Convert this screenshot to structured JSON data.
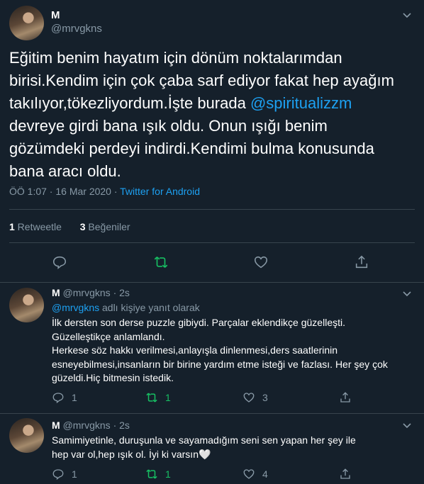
{
  "main": {
    "name": "M",
    "handle": "@mrvgkns",
    "text_before": "Eğitim benim hayatım için dönüm noktalarımdan\nbirisi.Kendim için çok çaba sarf ediyor fakat hep ayağım\ntakılıyor,tökezliyordum.İşte burada ",
    "mention": "@spiritualizzm",
    "text_after": "\n devreye girdi bana ışık oldu. Onun ışığı benim\ngözümdeki perdeyi indirdi.Kendimi bulma konusunda\nbana aracı oldu.",
    "time": "ÖÖ 1:07 · 16 Mar 2020 · ",
    "client": "Twitter for Android",
    "retweet_count": "1",
    "retweet_label": " Retweetle",
    "like_count": "3",
    "like_label": " Beğeniler"
  },
  "replies": [
    {
      "name": "M",
      "handle": "@mrvgkns",
      "age": "· 2s",
      "reply_to_mention": "@mrvgkns",
      "reply_to_suffix": " adlı kişiye yanıt olarak",
      "text": "İlk dersten son derse puzzle gibiydi. Parçalar eklendikçe güzelleşti.\nGüzelleştikçe anlamlandı.\n Herkese söz hakkı verilmesi,anlayışla dinlenmesi,ders saatlerinin\nesneyebilmesi,insanların bir birine yardım etme isteği ve fazlası. Her şey çok\ngüzeldi.Hiç bitmesin istedik.",
      "reply_count": "1",
      "retweet_count": "1",
      "like_count": "3"
    },
    {
      "name": "M",
      "handle": "@mrvgkns",
      "age": "· 2s",
      "text": "Samimiyetinle, duruşunla ve sayamadığım seni sen yapan her şey ile\nhep var ol,hep ışık ol. İyi ki varsın🤍",
      "reply_count": "1",
      "retweet_count": "1",
      "like_count": "4"
    }
  ],
  "colors": {
    "background": "#15202b",
    "accent": "#1da1f2",
    "secondary": "#8899a6",
    "retweet": "#17bf63"
  }
}
